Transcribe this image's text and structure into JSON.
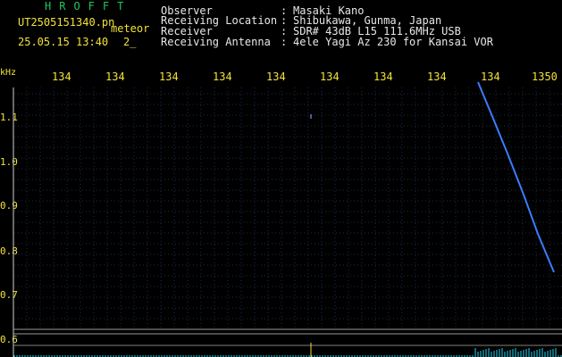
{
  "app": {
    "title": "HROFFT",
    "file_name": "UT2505151340.pn",
    "mode": "meteor",
    "datetime": "25.05.15 13:40",
    "count": "2_"
  },
  "info": [
    {
      "label": "Observer",
      "value": "Masaki Kano"
    },
    {
      "label": "Receiving Location",
      "value": "Shibukawa, Gunma, Japan"
    },
    {
      "label": "Receiver",
      "value": "SDR# 43dB L15 111.6MHz USB"
    },
    {
      "label": "Receiving Antenna",
      "value": "4ele Yagi Az 230 for Kansai VOR"
    }
  ],
  "plot": {
    "y_unit": "kHz",
    "x_ticks": [
      "134",
      "134",
      "134",
      "134",
      "134",
      "134",
      "134",
      "134",
      "134",
      "1350"
    ],
    "y_ticks": [
      "1.1",
      "1.0",
      "0.9",
      "0.8",
      "0.7",
      "0.6"
    ],
    "colors": {
      "background": "#000000",
      "grid": "#1e2d4a",
      "trace": "#3a7dff",
      "axis_text": "#f2e13a",
      "title": "#22c55e"
    }
  }
}
